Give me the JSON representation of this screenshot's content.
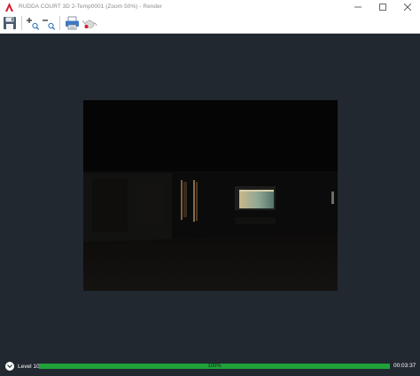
{
  "window": {
    "title": "RUDDA COURT 3D 2-Temp0001 (Zoom 50%) - Render",
    "controls": [
      "minimize",
      "maximize",
      "close"
    ]
  },
  "toolbar": {
    "buttons": [
      {
        "name": "save",
        "icon": "save-icon"
      },
      {
        "name": "zoom-in",
        "icon": "zoom-in-icon"
      },
      {
        "name": "zoom-out",
        "icon": "zoom-out-icon"
      },
      {
        "name": "print",
        "icon": "printer-icon"
      },
      {
        "name": "render-options",
        "icon": "teapot-icon"
      }
    ]
  },
  "status": {
    "level_label": "Level 10",
    "progress_text": "100%",
    "progress_value": 1.0,
    "elapsed_time": "00:03:37"
  },
  "colors": {
    "background": "#212830",
    "progress": "#1fa23a",
    "app_icon": "#d5192a"
  }
}
